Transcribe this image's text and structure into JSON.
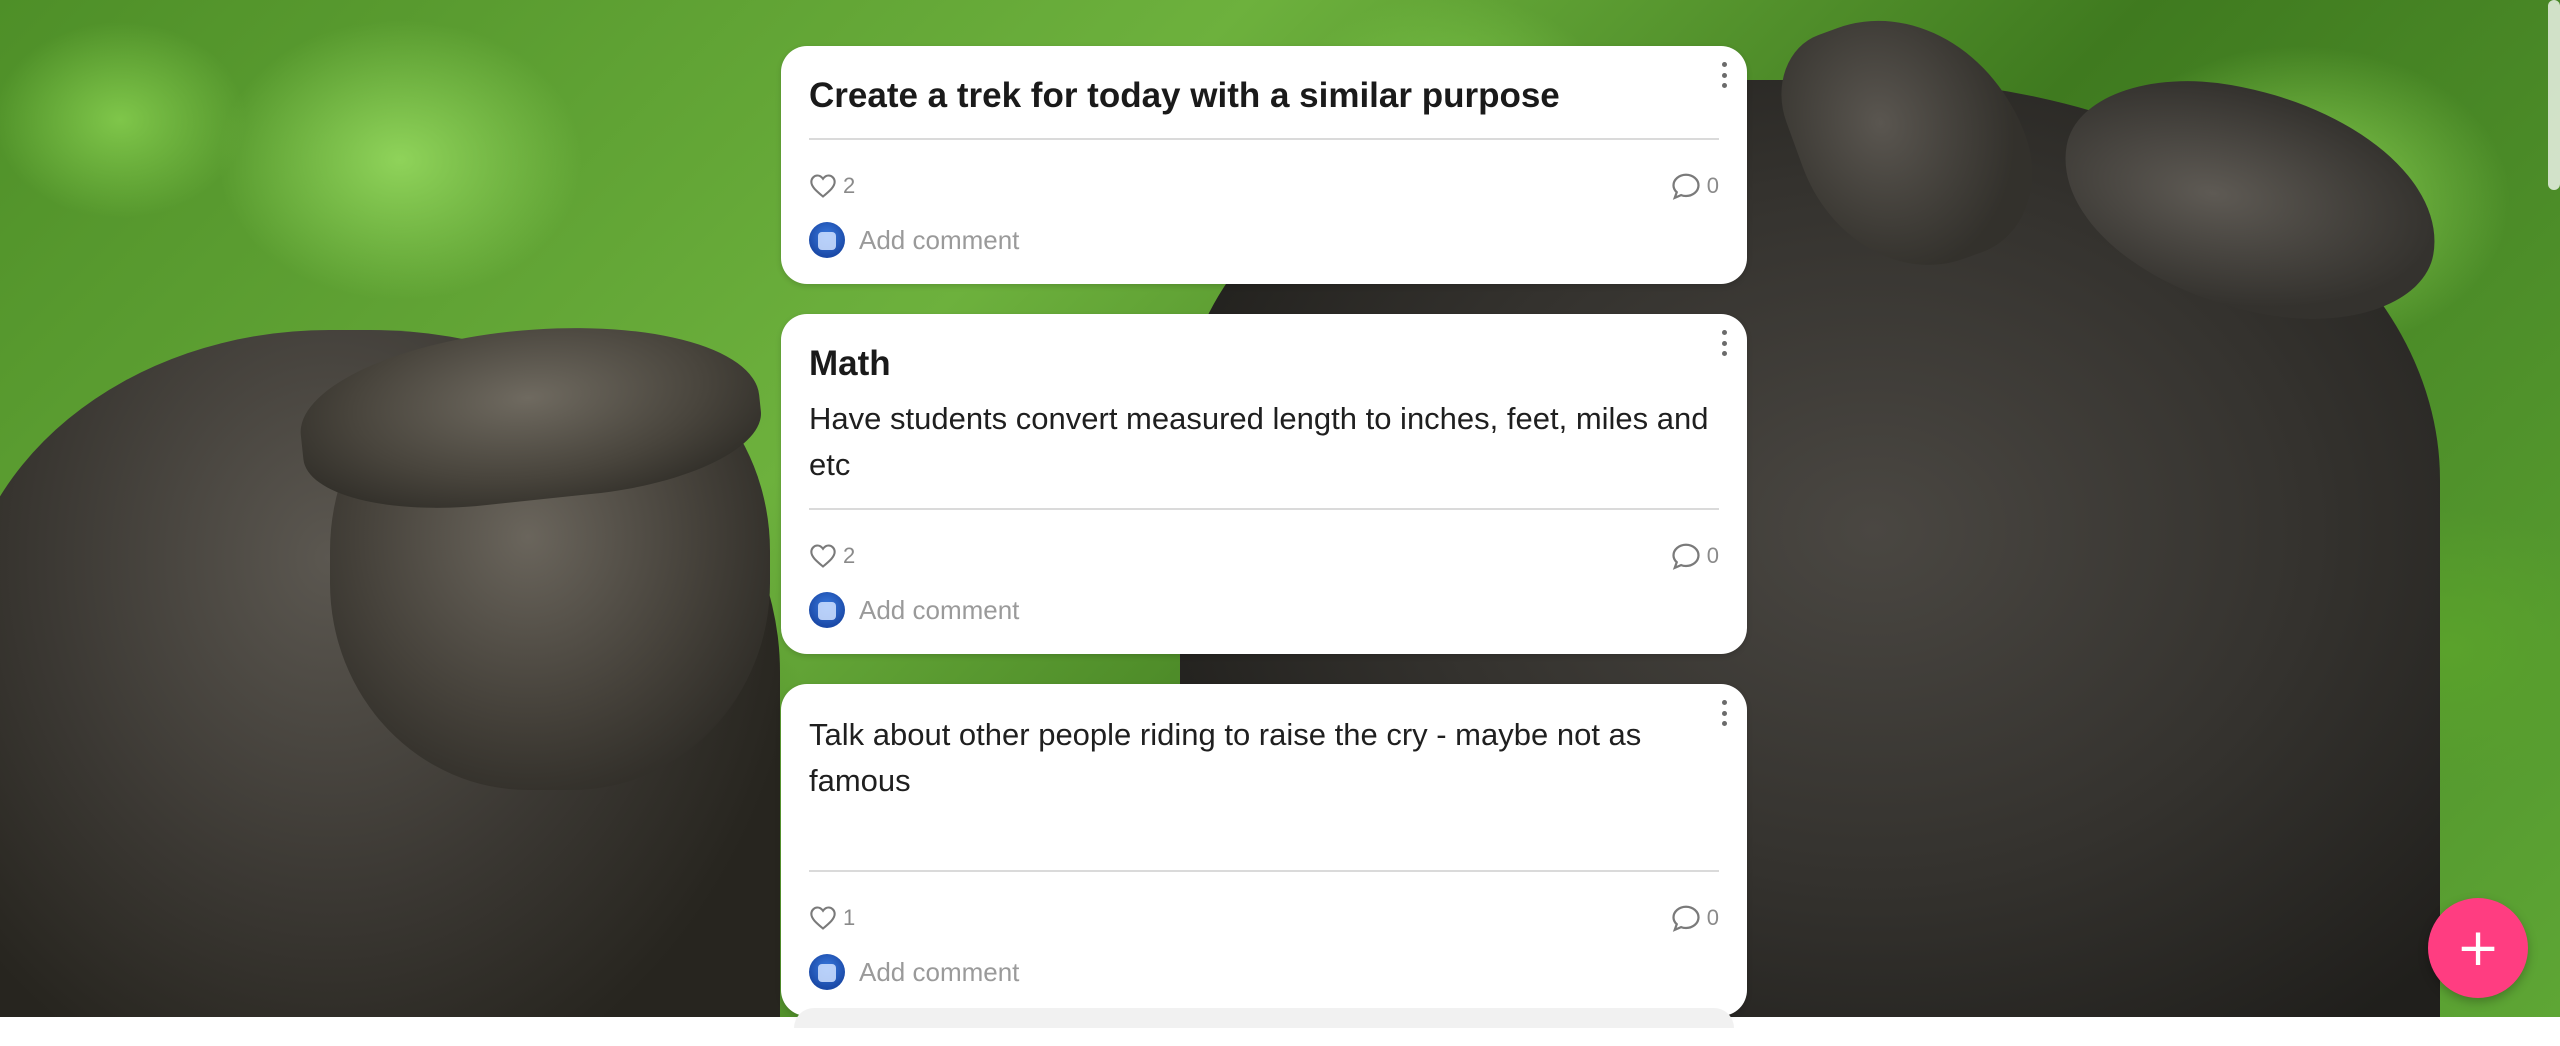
{
  "cards": [
    {
      "title": "Create a trek for today with a similar purpose",
      "body": "",
      "likes": "2",
      "comments": "0",
      "add_comment": "Add comment"
    },
    {
      "title": "Math",
      "body": "Have students convert measured length to inches, feet, miles and etc",
      "likes": "2",
      "comments": "0",
      "add_comment": "Add comment"
    },
    {
      "title": "",
      "body": "Talk about other people riding to raise the cry - maybe not as famous",
      "likes": "1",
      "comments": "0",
      "add_comment": "Add comment"
    }
  ],
  "fab": {
    "label": "+"
  },
  "icons": {
    "more": "more-vertical-icon",
    "like": "heart-icon",
    "comment": "comment-bubble-icon",
    "add": "plus-icon"
  },
  "colors": {
    "accent": "#ff3d81",
    "card_bg": "#ffffff",
    "meta_text": "#8a8a8a",
    "avatar": "#1b4aa8"
  }
}
